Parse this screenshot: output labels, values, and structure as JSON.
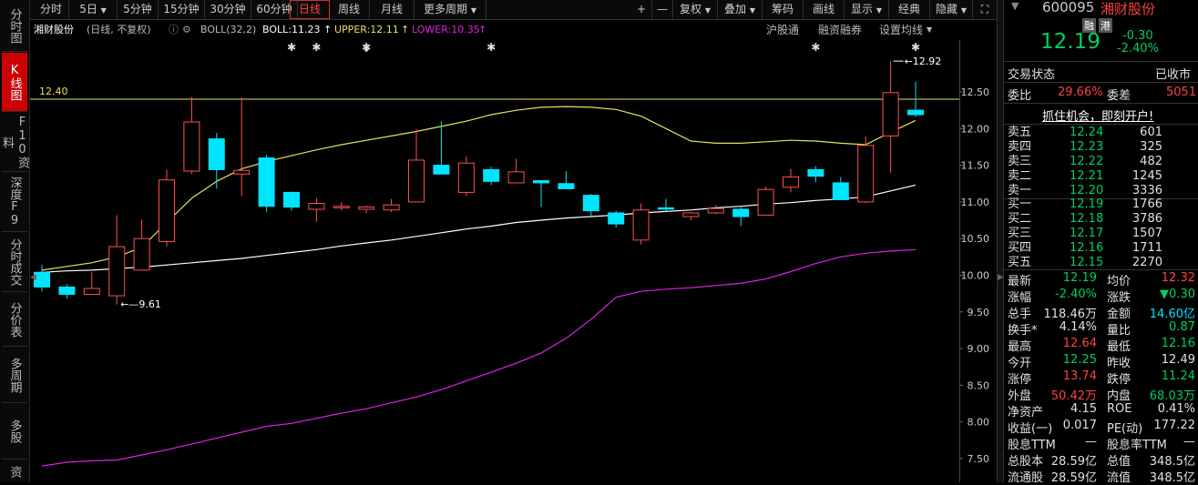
{
  "sidebar": {
    "tabs": [
      {
        "label": "分时图"
      },
      {
        "label": "K线图"
      },
      {
        "label": "F10资料"
      },
      {
        "label": "深度F9"
      },
      {
        "label": "分时成交"
      },
      {
        "label": "分价表"
      },
      {
        "label": "多周期"
      },
      {
        "label": "多股"
      },
      {
        "label": "资"
      }
    ]
  },
  "toolbar": {
    "periods": [
      "分时",
      "5日",
      "5分钟",
      "15分钟",
      "30分钟",
      "60分钟",
      "日线",
      "周线",
      "月线",
      "更多周期"
    ],
    "active_period": "日线",
    "tools": [
      "+",
      "—",
      "复权",
      "叠加",
      "筹码",
      "画线",
      "显示",
      "经典",
      "隐藏"
    ]
  },
  "infobar": {
    "stock_name": "湘财股份",
    "mode": "(日线, 不复权)",
    "indicator": "BOLL(32,2)",
    "boll": "BOLL:11.23",
    "upper": "UPPER:12.11",
    "lower": "LOWER:10.35",
    "links": [
      "沪股通",
      "融资融券",
      "设置均线"
    ]
  },
  "chart_data": {
    "type": "candlestick",
    "y_ticks": [
      "12.50",
      "12.00",
      "11.50",
      "11.00",
      "10.50",
      "10.00",
      "9.50",
      "9.00",
      "8.50",
      "8.00",
      "7.50"
    ],
    "ylim": [
      7.4,
      13.2
    ],
    "ref_line": {
      "value": 12.4,
      "label": "12.40"
    },
    "high_marker": {
      "value": 12.92,
      "label": "12.92"
    },
    "low_marker": {
      "value": 9.61,
      "label": "9.61"
    },
    "candles": [
      {
        "o": 10.04,
        "c": 9.84,
        "h": 10.14,
        "l": 9.78
      },
      {
        "o": 9.84,
        "c": 9.74,
        "h": 9.88,
        "l": 9.68
      },
      {
        "o": 9.74,
        "c": 9.82,
        "h": 10.04,
        "l": 9.74
      },
      {
        "o": 9.72,
        "c": 10.39,
        "h": 10.82,
        "l": 9.6
      },
      {
        "o": 10.07,
        "c": 10.5,
        "h": 10.76,
        "l": 10.07
      },
      {
        "o": 10.46,
        "c": 11.3,
        "h": 11.44,
        "l": 10.39
      },
      {
        "o": 11.42,
        "c": 12.09,
        "h": 12.43,
        "l": 11.38
      },
      {
        "o": 11.86,
        "c": 11.44,
        "h": 11.94,
        "l": 11.18
      },
      {
        "o": 11.38,
        "c": 11.43,
        "h": 12.42,
        "l": 11.08
      },
      {
        "o": 11.6,
        "c": 10.94,
        "h": 11.64,
        "l": 10.86
      },
      {
        "o": 11.13,
        "c": 10.93,
        "h": 11.14,
        "l": 10.88
      },
      {
        "o": 10.9,
        "c": 10.98,
        "h": 11.05,
        "l": 10.73
      },
      {
        "o": 10.92,
        "c": 10.94,
        "h": 11.0,
        "l": 10.88
      },
      {
        "o": 10.9,
        "c": 10.93,
        "h": 10.95,
        "l": 10.85
      },
      {
        "o": 10.89,
        "c": 10.96,
        "h": 11.04,
        "l": 10.86
      },
      {
        "o": 11.0,
        "c": 11.57,
        "h": 11.99,
        "l": 11.0
      },
      {
        "o": 11.5,
        "c": 11.38,
        "h": 12.1,
        "l": 11.38
      },
      {
        "o": 11.13,
        "c": 11.53,
        "h": 11.62,
        "l": 11.08
      },
      {
        "o": 11.44,
        "c": 11.28,
        "h": 11.48,
        "l": 11.23
      },
      {
        "o": 11.26,
        "c": 11.41,
        "h": 11.59,
        "l": 11.26
      },
      {
        "o": 11.29,
        "c": 11.26,
        "h": 11.29,
        "l": 10.93
      },
      {
        "o": 11.25,
        "c": 11.18,
        "h": 11.42,
        "l": 11.18
      },
      {
        "o": 11.09,
        "c": 10.88,
        "h": 11.11,
        "l": 10.8
      },
      {
        "o": 10.85,
        "c": 10.7,
        "h": 10.88,
        "l": 10.65
      },
      {
        "o": 10.48,
        "c": 10.89,
        "h": 10.98,
        "l": 10.42
      },
      {
        "o": 10.92,
        "c": 10.91,
        "h": 11.04,
        "l": 10.87
      },
      {
        "o": 10.8,
        "c": 10.85,
        "h": 10.86,
        "l": 10.75
      },
      {
        "o": 10.85,
        "c": 10.91,
        "h": 10.96,
        "l": 10.83
      },
      {
        "o": 10.9,
        "c": 10.8,
        "h": 10.93,
        "l": 10.67
      },
      {
        "o": 10.82,
        "c": 11.17,
        "h": 11.21,
        "l": 10.82
      },
      {
        "o": 11.2,
        "c": 11.34,
        "h": 11.45,
        "l": 11.13
      },
      {
        "o": 11.44,
        "c": 11.35,
        "h": 11.49,
        "l": 11.27
      },
      {
        "o": 11.26,
        "c": 11.03,
        "h": 11.34,
        "l": 11.03
      },
      {
        "o": 11.0,
        "c": 11.77,
        "h": 11.89,
        "l": 10.98
      },
      {
        "o": 11.9,
        "c": 12.49,
        "h": 12.92,
        "l": 11.4
      },
      {
        "o": 12.25,
        "c": 12.19,
        "h": 12.64,
        "l": 12.16
      }
    ],
    "series": [
      {
        "name": "UPPER",
        "color": "#e8e060",
        "values": [
          10.07,
          10.12,
          10.17,
          10.25,
          10.38,
          10.72,
          11.05,
          11.28,
          11.45,
          11.55,
          11.63,
          11.71,
          11.78,
          11.84,
          11.9,
          11.96,
          12.03,
          12.1,
          12.19,
          12.25,
          12.29,
          12.3,
          12.29,
          12.26,
          12.17,
          12.0,
          11.83,
          11.8,
          11.8,
          11.82,
          11.84,
          11.83,
          11.8,
          11.78,
          11.95,
          12.11
        ]
      },
      {
        "name": "BOLL",
        "color": "#ffffff",
        "values": [
          10.04,
          10.06,
          10.07,
          10.09,
          10.11,
          10.14,
          10.17,
          10.2,
          10.23,
          10.27,
          10.31,
          10.35,
          10.4,
          10.44,
          10.48,
          10.53,
          10.58,
          10.63,
          10.67,
          10.72,
          10.75,
          10.78,
          10.8,
          10.82,
          10.85,
          10.87,
          10.89,
          10.92,
          10.94,
          10.97,
          10.99,
          11.02,
          11.04,
          11.07,
          11.15,
          11.23
        ]
      },
      {
        "name": "LOWER",
        "color": "#e020e0",
        "values": [
          7.4,
          7.45,
          7.47,
          7.48,
          7.55,
          7.62,
          7.7,
          7.78,
          7.86,
          7.94,
          7.98,
          8.05,
          8.12,
          8.18,
          8.26,
          8.34,
          8.44,
          8.56,
          8.68,
          8.8,
          8.94,
          9.14,
          9.4,
          9.7,
          9.78,
          9.81,
          9.83,
          9.86,
          9.89,
          9.95,
          10.05,
          10.16,
          10.25,
          10.3,
          10.33,
          10.35
        ]
      }
    ],
    "star_markers": [
      10,
      11,
      13,
      18,
      31,
      35
    ],
    "arrow_marker": 13
  },
  "panel": {
    "code": "600095",
    "name": "湘财股份",
    "tags": [
      "融",
      "港"
    ],
    "price": "12.19",
    "change": "-0.30",
    "change_pct": "-2.40%",
    "status_label": "交易状态",
    "status_value": "已收市",
    "weibi_label": "委比",
    "weibi_value": "29.66%",
    "weicha_label": "委差",
    "weicha_value": "5051",
    "promo": "抓住机会，即刻开户!",
    "asks": [
      {
        "label": "卖五",
        "price": "12.24",
        "vol": "601"
      },
      {
        "label": "卖四",
        "price": "12.23",
        "vol": "325"
      },
      {
        "label": "卖三",
        "price": "12.22",
        "vol": "482"
      },
      {
        "label": "卖二",
        "price": "12.21",
        "vol": "1245"
      },
      {
        "label": "卖一",
        "price": "12.20",
        "vol": "3336"
      }
    ],
    "bids": [
      {
        "label": "买一",
        "price": "12.19",
        "vol": "1766"
      },
      {
        "label": "买二",
        "price": "12.18",
        "vol": "3786"
      },
      {
        "label": "买三",
        "price": "12.17",
        "vol": "1507"
      },
      {
        "label": "买四",
        "price": "12.16",
        "vol": "1711"
      },
      {
        "label": "买五",
        "price": "12.15",
        "vol": "2270"
      }
    ],
    "stats": [
      {
        "l1": "最新",
        "v1": "12.19",
        "c1": "green",
        "l2": "均价",
        "v2": "12.32",
        "c2": "red"
      },
      {
        "l1": "涨幅",
        "v1": "-2.40%",
        "c1": "green",
        "l2": "涨跌",
        "v2": "▼0.30",
        "c2": "green"
      },
      {
        "l1": "总手",
        "v1": "118.46万",
        "c1": "white",
        "l2": "金额",
        "v2": "14.60亿",
        "c2": "cyan"
      },
      {
        "l1": "换手*",
        "v1": "4.14%",
        "c1": "white",
        "l2": "量比",
        "v2": "0.87",
        "c2": "green"
      },
      {
        "l1": "最高",
        "v1": "12.64",
        "c1": "red",
        "l2": "最低",
        "v2": "12.16",
        "c2": "green"
      },
      {
        "l1": "今开",
        "v1": "12.25",
        "c1": "green",
        "l2": "昨收",
        "v2": "12.49",
        "c2": "white"
      },
      {
        "l1": "涨停",
        "v1": "13.74",
        "c1": "red",
        "l2": "跌停",
        "v2": "11.24",
        "c2": "green"
      },
      {
        "l1": "外盘",
        "v1": "50.42万",
        "c1": "red",
        "l2": "内盘",
        "v2": "68.03万",
        "c2": "green"
      },
      {
        "l1": "净资产",
        "v1": "4.15",
        "c1": "white",
        "l2": "ROE",
        "v2": "0.41%",
        "c2": "white"
      },
      {
        "l1": "收益(一)",
        "v1": "0.017",
        "c1": "white",
        "l2": "PE(动)",
        "v2": "177.22",
        "c2": "white"
      },
      {
        "l1": "股息TTM",
        "v1": "—",
        "c1": "white",
        "l2": "股息率TTM",
        "v2": "—",
        "c2": "white"
      },
      {
        "l1": "总股本",
        "v1": "28.59亿",
        "c1": "white",
        "l2": "总值",
        "v2": "348.5亿",
        "c2": "white"
      },
      {
        "l1": "流通股",
        "v1": "28.59亿",
        "c1": "white",
        "l2": "流值",
        "v2": "348.5亿",
        "c2": "white"
      }
    ]
  }
}
